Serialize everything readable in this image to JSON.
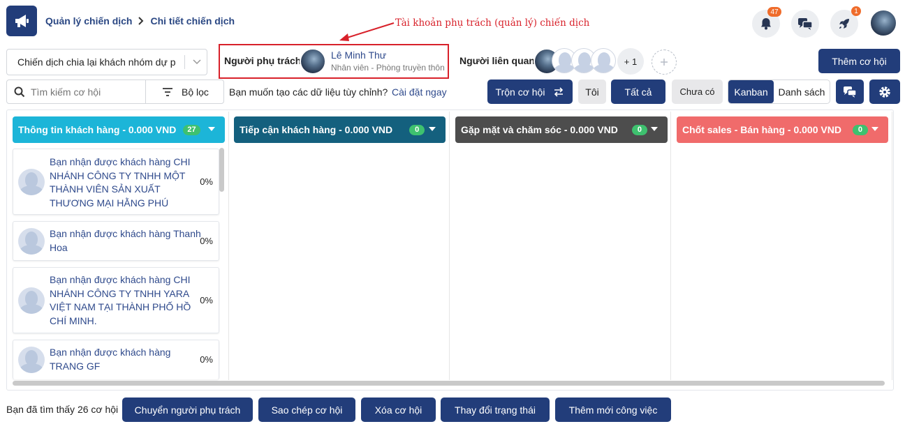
{
  "header": {
    "breadcrumb_parent": "Quản lý chiến dịch",
    "breadcrumb_current": "Chi tiết chiến dịch",
    "notif_count": "47",
    "rocket_count": "1"
  },
  "annotation": {
    "text": "Tài khoản phụ trách (quản lý) chiến dịch",
    "color": "#d8212a"
  },
  "campaign_select": {
    "value": "Chiến dịch chia lại khách nhóm dự p"
  },
  "owner": {
    "label": "Người phụ trách",
    "name": "Lê Minh Thư",
    "role": "Nhân viên - Phòng truyền thôn"
  },
  "related": {
    "label": "Người liên quan",
    "more": "+ 1"
  },
  "add_opportunity_label": "Thêm cơ hội",
  "search": {
    "placeholder": "Tìm kiếm cơ hội"
  },
  "filter_label": "Bộ lọc",
  "custom_prompt": "Bạn muốn tạo các dữ liệu tùy chỉnh?",
  "custom_link": "Cài đặt ngay",
  "toolbar": {
    "merge_label": "Trộn cơ hội",
    "me_label": "Tôi",
    "all_label": "Tất cả",
    "none_label": "Chưa có",
    "kanban_label": "Kanban",
    "list_label": "Danh sách"
  },
  "columns": [
    {
      "title": "Thông tin khách hàng - 0.000 VND",
      "count": "27",
      "color": "#1cb5d8"
    },
    {
      "title": "Tiếp cận khách hàng - 0.000 VND",
      "count": "0",
      "color": "#14607e"
    },
    {
      "title": "Gặp mặt và chăm sóc - 0.000 VND",
      "count": "0",
      "color": "#4d4d4d"
    },
    {
      "title": "Chốt sales - Bán hàng - 0.000 VND",
      "count": "0",
      "color": "#f06b6b"
    }
  ],
  "cards": [
    {
      "text": "Bạn nhận được khách hàng CHI NHÁNH CÔNG TY TNHH MỘT THÀNH VIÊN SẢN XUẤT THƯƠNG MẠI HẰNG PHÚ",
      "percent": "0%"
    },
    {
      "text": "Bạn nhận được khách hàng Thanh Hoa",
      "percent": "0%"
    },
    {
      "text": "Bạn nhận được khách hàng CHI NHÁNH CÔNG TY TNHH YARA VIỆT NAM TẠI THÀNH PHỐ HỒ CHÍ MINH.",
      "percent": "0%"
    },
    {
      "text": "Bạn nhận được khách hàng TRANG GF",
      "percent": "0%"
    }
  ],
  "footer": {
    "found_text": "Bạn đã tìm thấy 26 cơ hội",
    "actions": [
      "Chuyển người phụ trách",
      "Sao chép cơ hội",
      "Xóa cơ hội",
      "Thay đổi trạng thái",
      "Thêm mới công việc"
    ]
  }
}
